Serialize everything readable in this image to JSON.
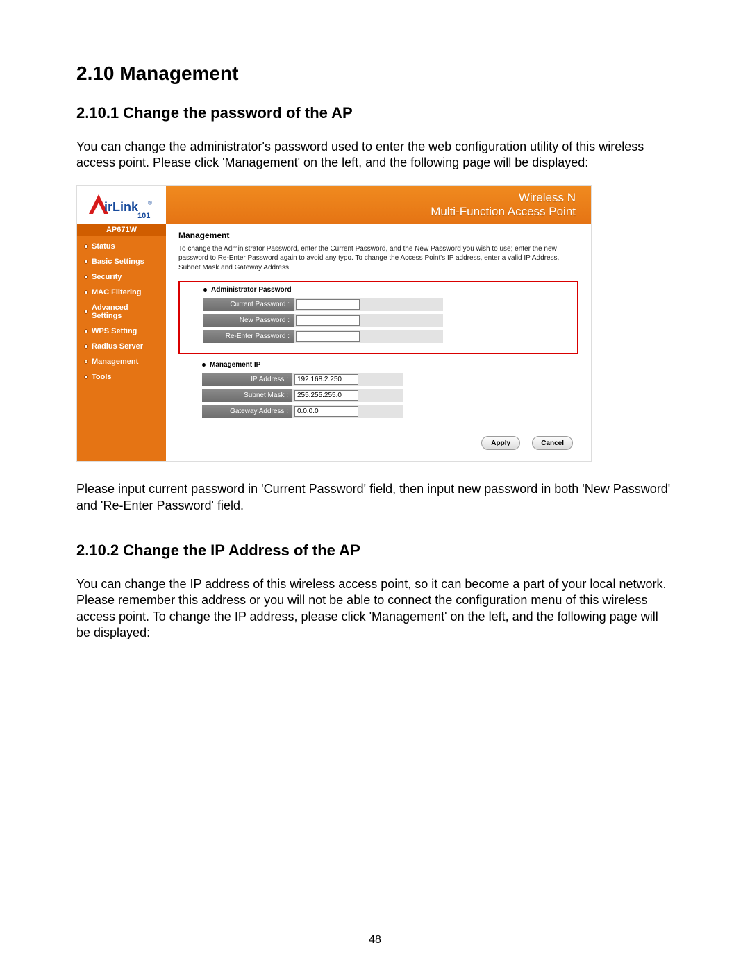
{
  "doc": {
    "h1": "2.10 Management",
    "h2a": "2.10.1 Change the password of the AP",
    "p1": "You can change the administrator's password used to enter the web configuration utility of this wireless access point. Please click 'Management' on the left, and the following page will be displayed:",
    "p2": "Please input current password in 'Current Password' field, then input new password in both 'New Password' and 'Re-Enter Password' field.",
    "h2b": "2.10.2 Change the IP Address of the AP",
    "p3": "You can change the IP address of this wireless access point, so it can become a part of your local network. Please remember this address or you will not be able to connect the configuration menu of this wireless access point. To change the IP address, please click 'Management' on the left, and the following page will be displayed:",
    "page_number": "48"
  },
  "ui": {
    "brand_line1": "irLink",
    "brand_sub": "101",
    "banner_line1": "Wireless N",
    "banner_line2": "Multi-Function Access Point",
    "model": "AP671W",
    "nav": {
      "items": [
        {
          "label": "Status"
        },
        {
          "label": "Basic Settings"
        },
        {
          "label": "Security"
        },
        {
          "label": "MAC Filtering"
        },
        {
          "label": "Advanced Settings"
        },
        {
          "label": "WPS Setting"
        },
        {
          "label": "Radius Server"
        },
        {
          "label": "Management"
        },
        {
          "label": "Tools"
        }
      ],
      "active_index": 7
    },
    "main": {
      "title": "Management",
      "desc": "To change the Administrator Password, enter the Current Password, and the New Password you wish to use; enter the new password to Re-Enter Password again to avoid any typo. To change the Access Point's IP address, enter a valid IP Address, Subnet Mask and Gateway Address.",
      "section_pw": "Administrator Password",
      "pw": {
        "current_label": "Current Password :",
        "new_label": "New Password :",
        "re_label": "Re-Enter Password :",
        "current_value": "",
        "new_value": "",
        "re_value": ""
      },
      "section_ip": "Management IP",
      "ip": {
        "addr_label": "IP Address :",
        "mask_label": "Subnet Mask :",
        "gw_label": "Gateway Address :",
        "addr_value": "192.168.2.250",
        "mask_value": "255.255.255.0",
        "gw_value": "0.0.0.0"
      },
      "apply": "Apply",
      "cancel": "Cancel"
    }
  }
}
